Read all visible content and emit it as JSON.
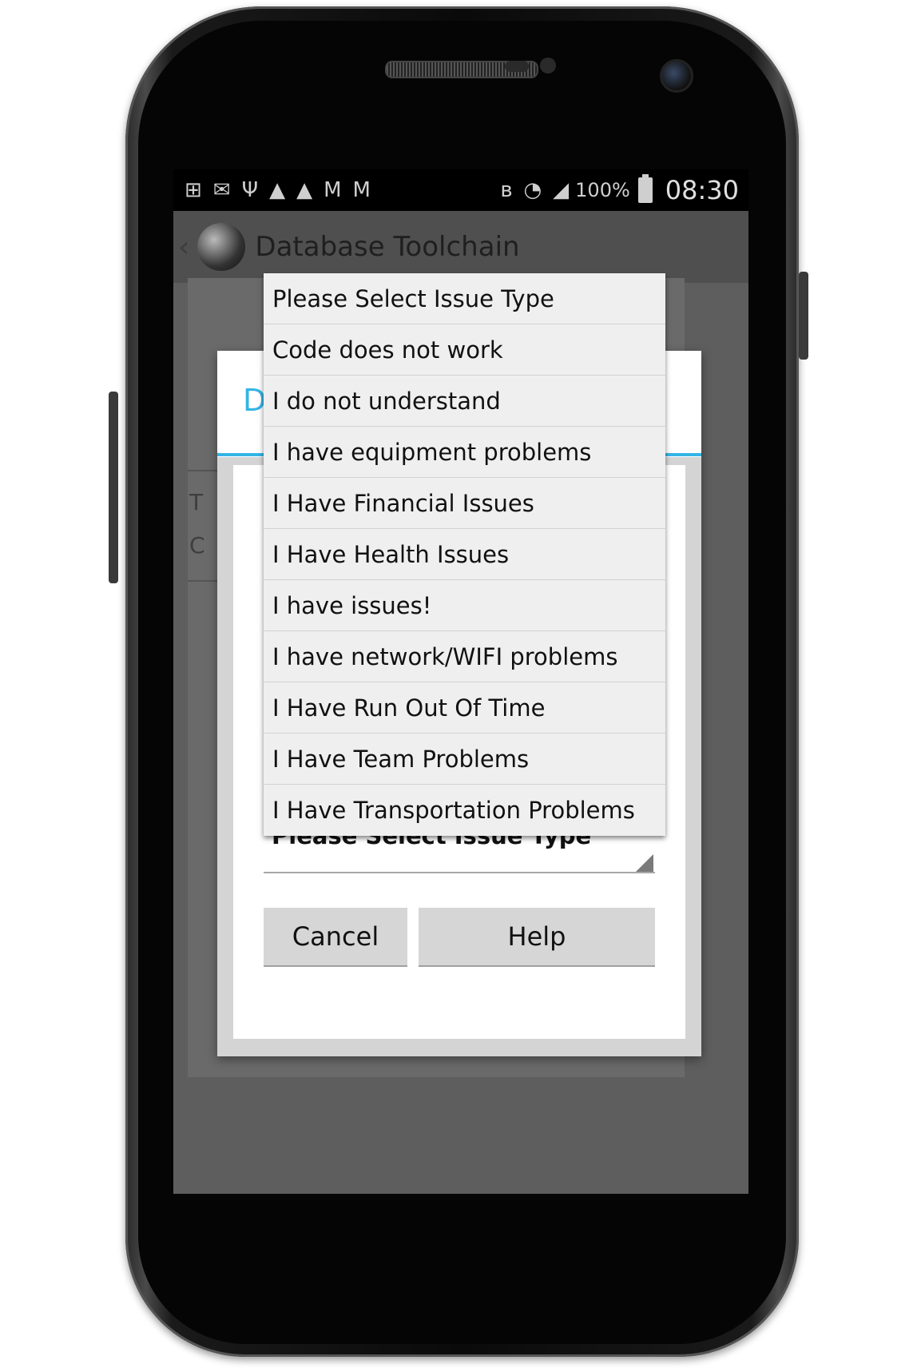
{
  "status_bar": {
    "battery": "100%",
    "time": "08:30",
    "left_icons": [
      "add-box-icon",
      "email-icon",
      "usb-icon",
      "warning-icon",
      "warning-icon",
      "gmail-icon",
      "gmail-icon"
    ],
    "right_icons": [
      "bluetooth-icon",
      "wifi-icon",
      "signal-icon",
      "battery-icon"
    ]
  },
  "action_bar": {
    "title": "Database Toolchain"
  },
  "dialog": {
    "title_initial": "D",
    "spinner_value": "Please Select Issue Type",
    "cancel_label": "Cancel",
    "help_label": "Help"
  },
  "dropdown": {
    "options": [
      "Please Select Issue Type",
      "Code does not work",
      "I do not understand",
      "I have equipment problems",
      "I Have Financial Issues",
      "I Have Health Issues",
      "I have issues!",
      "I have network/WIFI problems",
      "I Have Run Out Of Time",
      "I Have Team Problems",
      "I Have Transportation Problems"
    ]
  },
  "background": {
    "partial_text_1": "T",
    "partial_text_2": "C",
    "help_icon": "?",
    "profile_icon": "person-icon"
  },
  "colors": {
    "accent": "#33b5e5",
    "dim_background": "#5e5e5e",
    "dropdown_background": "#efefef"
  }
}
